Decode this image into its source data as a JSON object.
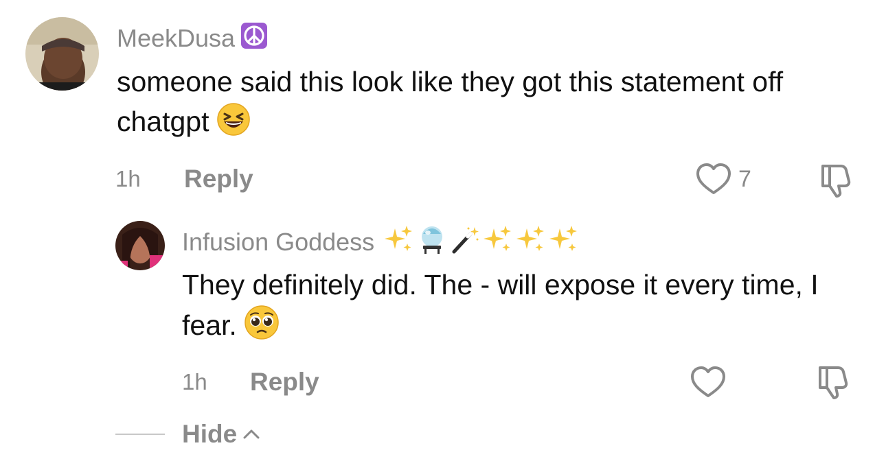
{
  "comment": {
    "username": "MeekDusa",
    "text": "someone said this look like they got this statement off chatgpt",
    "time": "1h",
    "reply_label": "Reply",
    "like_count": "7"
  },
  "reply": {
    "username": "Infusion Goddess",
    "text": "They definitely did. The - will expose it every time, I fear.",
    "time": "1h",
    "reply_label": "Reply"
  },
  "hide_label": "Hide",
  "icons": {
    "peace": "peace-symbol-icon",
    "laughing": "grinning-squinting-face-icon",
    "pleading": "pleading-face-icon",
    "sparkles": "sparkles-icon",
    "crystal_ball": "crystal-ball-icon",
    "wand": "magic-wand-icon",
    "heart": "heart-outline-icon",
    "dislike": "thumbs-down-outline-icon",
    "chevron": "chevron-up-icon"
  },
  "colors": {
    "text": "#111111",
    "muted": "#8a8a8a",
    "badge_purple": "#9b59d0",
    "sparkle": "#f7c83d"
  }
}
